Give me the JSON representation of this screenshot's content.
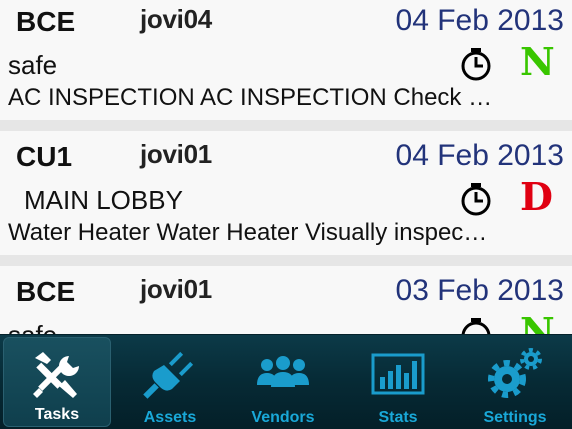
{
  "tasks": [
    {
      "code": "BCE",
      "user": "jovi04",
      "date": "04 Feb 2013",
      "location": "safe",
      "description": "AC INSPECTION AC INSPECTION Check …",
      "priority": "N",
      "priority_color": "#39c600",
      "icon": "alarm-clock-icon"
    },
    {
      "code": "CU1",
      "user": "jovi01",
      "date": "04 Feb 2013",
      "location": "MAIN LOBBY",
      "description": "Water Heater Water Heater Visually inspec…",
      "priority": "D",
      "priority_color": "#e00012",
      "icon": "alarm-clock-icon"
    },
    {
      "code": "BCE",
      "user": "jovi01",
      "date": "03 Feb 2013",
      "location": "safe",
      "description": "",
      "priority": "N",
      "priority_color": "#39c600",
      "icon": "alarm-clock-icon"
    }
  ],
  "tabbar": {
    "active": "Tasks",
    "tabs": [
      {
        "label": "Tasks",
        "icon": "wrench-screwdriver-icon"
      },
      {
        "label": "Assets",
        "icon": "plug-icon"
      },
      {
        "label": "Vendors",
        "icon": "people-icon"
      },
      {
        "label": "Stats",
        "icon": "bar-chart-icon"
      },
      {
        "label": "Settings",
        "icon": "gears-icon"
      }
    ],
    "accent_color": "#19a8d8"
  }
}
